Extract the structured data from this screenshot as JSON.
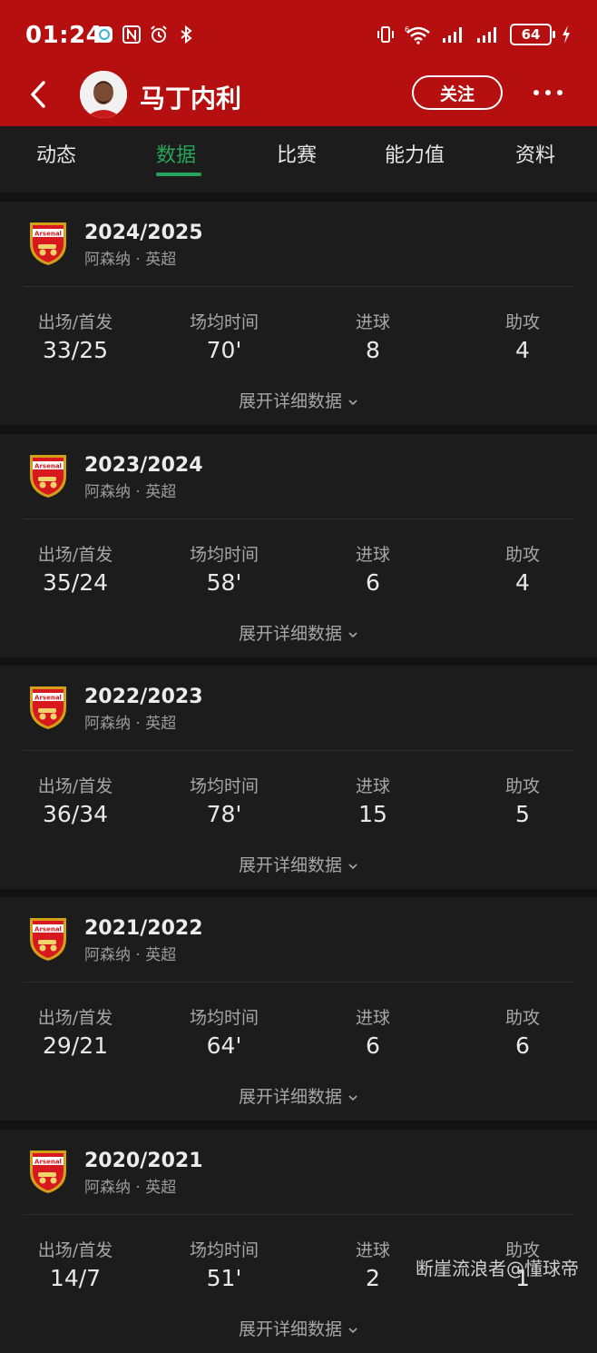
{
  "status_bar": {
    "time": "01:24",
    "battery": "64",
    "signal_label": "6"
  },
  "header": {
    "player_name": "马丁内利",
    "follow_label": "关注"
  },
  "tabs": [
    {
      "label": "动态"
    },
    {
      "label": "数据"
    },
    {
      "label": "比赛"
    },
    {
      "label": "能力值"
    },
    {
      "label": "资料"
    }
  ],
  "active_tab": "数据",
  "stat_labels": {
    "apps": "出场/首发",
    "avg_time": "场均时间",
    "goals": "进球",
    "assists": "助攻"
  },
  "expand_label": "展开详细数据",
  "club_crest_text": "Arsenal",
  "seasons": [
    {
      "season": "2024/2025",
      "club_league": "阿森纳 · 英超",
      "apps": "33/25",
      "avg_time": "70'",
      "goals": "8",
      "assists": "4"
    },
    {
      "season": "2023/2024",
      "club_league": "阿森纳 · 英超",
      "apps": "35/24",
      "avg_time": "58'",
      "goals": "6",
      "assists": "4"
    },
    {
      "season": "2022/2023",
      "club_league": "阿森纳 · 英超",
      "apps": "36/34",
      "avg_time": "78'",
      "goals": "15",
      "assists": "5"
    },
    {
      "season": "2021/2022",
      "club_league": "阿森纳 · 英超",
      "apps": "29/21",
      "avg_time": "64'",
      "goals": "6",
      "assists": "6"
    },
    {
      "season": "2020/2021",
      "club_league": "阿森纳 · 英超",
      "apps": "14/7",
      "avg_time": "51'",
      "goals": "2",
      "assists": "1"
    }
  ],
  "watermark": "断崖流浪者@懂球帝",
  "colors": {
    "header_red": "#b5100f",
    "accent_green": "#27a55a",
    "card_bg": "#1c1c1c",
    "page_bg": "#121212"
  }
}
